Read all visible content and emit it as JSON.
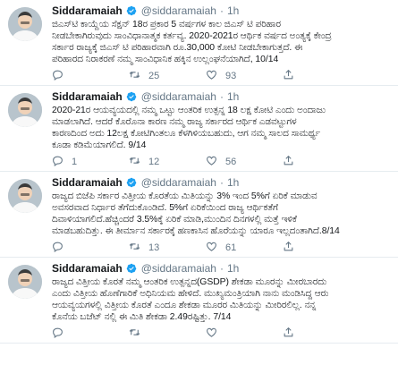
{
  "tweets": [
    {
      "name": "Siddaramaiah",
      "handle": "@siddaramaiah",
      "dot": "·",
      "time": "1h",
      "lines": [
        "ಜಿಎಸ್‌ಟಿ ಕಾಯ್ದೆಯ ಸೆಕ್ಷನ್ 18ರ ಪ್ರಕಾರ 5 ವರ್ಷಗಳ ಕಾಲ ಜಿಎಸ್ ಟಿ ಪರಿಹಾರ",
        "ನೀಡಬೇಕಾಗಿರುವುದು ಸಾಂವಿಧಾನಾತ್ಮಕ ಕರ್ತವ್ಯ. 2020-2021ರ ಆರ್ಥಿಕ ವರ್ಷದ ಅಂತ್ಯಕ್ಕೆ ಕೇಂದ್ರ",
        "ಸರ್ಕಾರ ರಾಜ್ಯಕ್ಕೆ ಜಿಎಸ್ ಟಿ ಪರಿಹಾರವಾಗಿ ರೂ.30,000 ಕೋಟಿ ನೀಡಬೇಕಾಗುತ್ತದೆ. ಈ",
        "ಪರಿಹಾರದ ನಿರಾಕರಣೆ ನಮ್ಮ ಸಾಂವಿಧಾನಿಕ ಹಕ್ಕಿನ ಉಲ್ಲಂಘನೆಯಾಗಿದೆ, 10/14"
      ],
      "replies": "",
      "retweets": "25",
      "likes": "93"
    },
    {
      "name": "Siddaramaiah",
      "handle": "@siddaramaiah",
      "dot": "·",
      "time": "1h",
      "lines": [
        "2020-21ರ ಆಯವ್ಯಯದಲ್ಲಿ ನಮ್ಮ ಒಟ್ಟು ಆಂತರಿಕ ಉತ್ಪನ್ನ 18 ಲಕ್ಷ ಕೋಟಿ ಎಂದು ಅಂದಾಜು",
        "ಮಾಡಲಾಗಿದೆ. ಆದರೆ ಕೊರೊನಾ ಕಾರಣ ನಮ್ಮ ರಾಜ್ಯ ಸರ್ಕಾರದ ಆರ್ಥಿಕ ಎಡವಟ್ಟುಗಳ",
        "ಕಾರಣದಿಂದ ಅದು 12ಲಕ್ಷ ಕೋಟಿಗಿಂತಲೂ ಕೆಳಗಿಳಿಯಬಹುದು, ಆಗ ನಮ್ಮ ಸಾಲದ ಸಾಮರ್ಥ್ಯ",
        "ಕೂಡಾ ಕಡಿಮೆಯಾಗಲಿದೆ. 9/14"
      ],
      "replies": "1",
      "retweets": "12",
      "likes": "56"
    },
    {
      "name": "Siddaramaiah",
      "handle": "@siddaramaiah",
      "dot": "·",
      "time": "1h",
      "lines": [
        "ರಾಜ್ಯದ ಬಿಜೆಪಿ ಸರ್ಕಾರ ವಿತ್ತೀಯ ಕೊರತೆಯ ಮಿತಿಯನ್ನು 3% ಇಂದ 5%ಗೆ ಏರಿಕೆ ಮಾಡುವ",
        "ಅವಸರವಾದ ನಿರ್ಧಾರ ತೆಗೆದುಕೊಂಡಿದೆ. 5%ಗೆ ಏರಿಕೆಯಿಂದ ರಾಜ್ಯ ಆರ್ಥಿಕತೆಗೆ",
        "ದಿವಾಳಿಯಾಗಲಿದೆ.ಹೆಚ್ಚಿಂದರೆ 3.5%ಕ್ಕೆ ಏರಿಕೆ ಮಾಡಿ,ಮುಂದಿನ ದಿನಗಳಲ್ಲಿ ಮತ್ತೆ ಇಳಿಕೆ",
        "ಮಾಡಬಹುದಿತ್ತು. ಈ ತೀರ್ಮಾನ ಸರ್ಕಾರಕ್ಕೆ ಹಣಕಾಸಿನ ಹೊರೆಯನ್ನು ಯಾರೂ ಇಲ್ಲದಂತಾಗಿದೆ.8/14"
      ],
      "replies": "",
      "retweets": "13",
      "likes": "61"
    },
    {
      "name": "Siddaramaiah",
      "handle": "@siddaramaiah",
      "dot": "·",
      "time": "1h",
      "lines": [
        "ರಾಜ್ಯದ ವಿತ್ತೀಯ ಕೊರತೆ ನಮ್ಮ ಆಂತರಿಕ ಉತ್ಪನ್ನದ(GSDP) ಶೇಕಡಾ ಮೂರನ್ನು ಮೀರಬಾರದು",
        "ಎಂದು ವಿತ್ತೀಯ ಹೊಣೆಗಾರಿಕೆ ಅಧಿನಿಯಮ ಹೇಳಿದೆ. ಮುಖ್ಯಮಂತ್ರಿಯಾಗಿ ನಾನು ಮಂಡಿಸಿದ್ದ ಆರು",
        "ಆಯವ್ಯಯಗಳಲ್ಲಿ ವಿತ್ತೀಯ ಕೊರತೆ ಎಂದೂ ಶೇಕಡಾ ಮೂರರ ಮಿತಿಯನ್ನು ಮೀರಿರಲಿಲ್ಲ. ನನ್ನ",
        "ಕೊನೆಯ ಬಜೆಟ್ ನಲ್ಲಿ ಈ ಮಿತಿ ಶೇಕಡಾ 2.49ರಷ್ಟಿತ್ತು. 7/14"
      ],
      "replies": "",
      "retweets": "",
      "likes": ""
    }
  ],
  "colors": {
    "text": "#14171a",
    "secondary": "#657786",
    "verified": "#1da1f2",
    "divider": "#e6ecf0"
  },
  "icons": [
    "verified-badge-icon",
    "reply-icon",
    "retweet-icon",
    "like-icon",
    "share-icon"
  ]
}
